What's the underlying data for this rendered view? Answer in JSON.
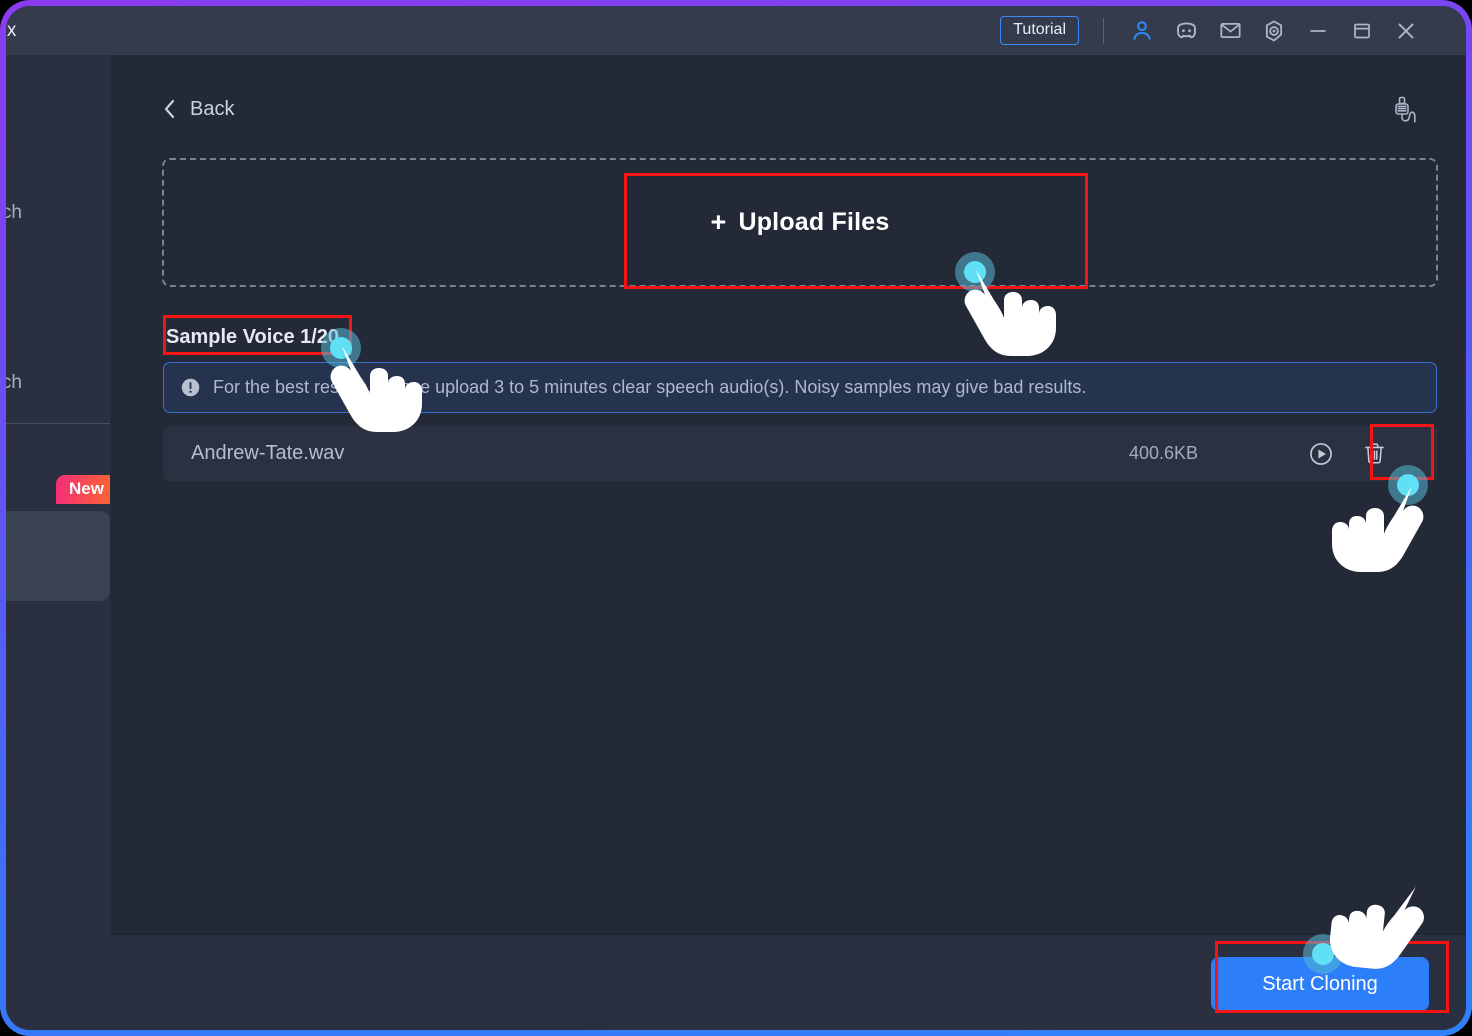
{
  "window": {
    "app_title": "ox",
    "accent_border_top": "#8b3bf0",
    "accent_border_bottom": "#2f82fb"
  },
  "titlebar": {
    "tutorial_label": "Tutorial",
    "icons": [
      {
        "name": "account-icon",
        "label": "Account"
      },
      {
        "name": "discord-icon",
        "label": "Discord"
      },
      {
        "name": "mail-icon",
        "label": "Mail"
      },
      {
        "name": "settings-icon",
        "label": "Settings"
      },
      {
        "name": "minimize-icon",
        "label": "Minimize"
      },
      {
        "name": "maximize-icon",
        "label": "Maximize"
      },
      {
        "name": "close-icon",
        "label": "Close"
      }
    ]
  },
  "sidebar": {
    "item_1_label": "ch",
    "item_2_label": "ch",
    "new_badge": "New"
  },
  "header": {
    "back_label": "Back",
    "mic_icon_name": "microphone-cable-icon"
  },
  "dropzone": {
    "plus": "+",
    "upload_label": "Upload Files"
  },
  "sample_section": {
    "title": "Sample Voice 1/20",
    "info_text": "For the best results, please upload 3 to 5 minutes clear speech audio(s). Noisy samples may give bad results."
  },
  "file_row": {
    "name": "Andrew-Tate.wav",
    "size": "400.6KB",
    "play_icon": "play-circle-icon",
    "delete_icon": "trash-icon"
  },
  "bottom_bar": {
    "start_cloning_label": "Start Cloning",
    "button_color": "#2d7ff9"
  },
  "annotations": {
    "highlight_color": "#f41414",
    "cursor_ripple_color": "#5fe0f5",
    "boxes": [
      {
        "name": "upload-files-highlight"
      },
      {
        "name": "sample-voice-highlight"
      },
      {
        "name": "delete-button-highlight"
      },
      {
        "name": "start-cloning-highlight"
      }
    ]
  }
}
